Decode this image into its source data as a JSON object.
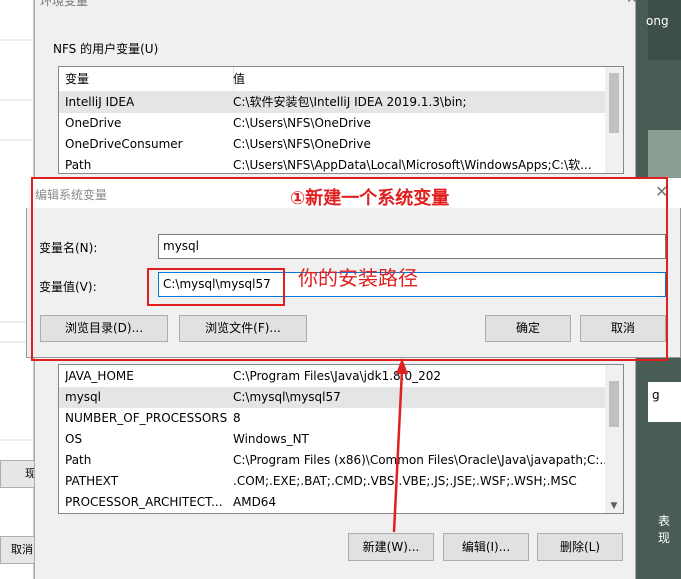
{
  "background": {
    "left_buttons": [
      "现",
      "取消"
    ],
    "right_texts": [
      "ong",
      "g",
      "表现"
    ]
  },
  "env_dialog": {
    "title": "环境变量",
    "user_vars_label": "NFS 的用户变量(U)",
    "columns": [
      "变量",
      "值"
    ],
    "user_vars": [
      {
        "name": "IntelliJ IDEA",
        "value": "C:\\软件安装包\\IntelliJ IDEA 2019.1.3\\bin;"
      },
      {
        "name": "OneDrive",
        "value": "C:\\Users\\NFS\\OneDrive"
      },
      {
        "name": "OneDriveConsumer",
        "value": "C:\\Users\\NFS\\OneDrive"
      },
      {
        "name": "Path",
        "value": "C:\\Users\\NFS\\AppData\\Local\\Microsoft\\WindowsApps;C:\\软..."
      }
    ],
    "system_vars": [
      {
        "name": "JAVA_HOME",
        "value": "C:\\Program Files\\Java\\jdk1.8.0_202"
      },
      {
        "name": "mysql",
        "value": "C:\\mysql\\mysql57"
      },
      {
        "name": "NUMBER_OF_PROCESSORS",
        "value": "8"
      },
      {
        "name": "OS",
        "value": "Windows_NT"
      },
      {
        "name": "Path",
        "value": "C:\\Program Files (x86)\\Common Files\\Oracle\\Java\\javapath;C:..."
      },
      {
        "name": "PATHEXT",
        "value": ".COM;.EXE;.BAT;.CMD;.VBS;.VBE;.JS;.JSE;.WSF;.WSH;.MSC"
      },
      {
        "name": "PROCESSOR_ARCHITECT...",
        "value": "AMD64"
      }
    ],
    "buttons": {
      "new": "新建(W)...",
      "edit": "编辑(I)...",
      "delete": "删除(L)"
    }
  },
  "edit_dialog": {
    "title": "编辑系统变量",
    "name_label": "变量名(N):",
    "value_label": "变量值(V):",
    "name_value": "mysql",
    "value_value": "C:\\mysql\\mysql57",
    "buttons": {
      "browse_dir": "浏览目录(D)...",
      "browse_file": "浏览文件(F)...",
      "ok": "确定",
      "cancel": "取消"
    }
  },
  "annotations": {
    "step1": "①新建一个系统变量",
    "install_path": "你的安装路径",
    "color": "#e02020"
  }
}
